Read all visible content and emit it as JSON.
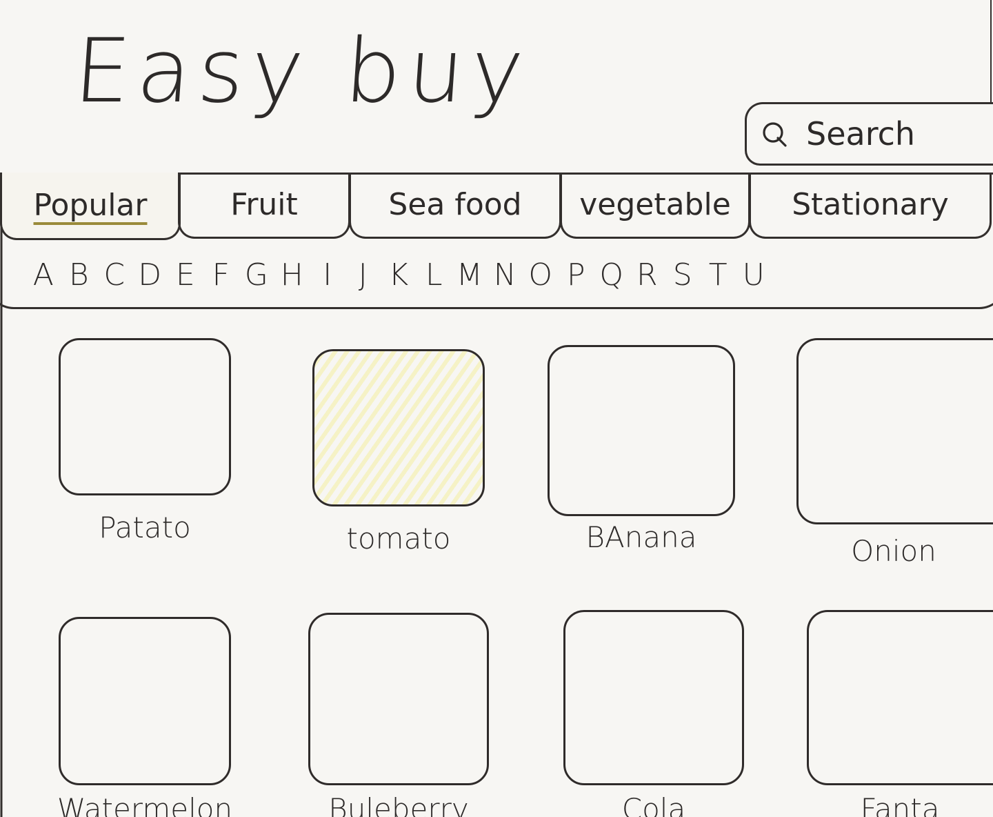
{
  "header": {
    "title": "Easy buy"
  },
  "search": {
    "placeholder": "Search",
    "icon": "search-icon"
  },
  "tabs": [
    {
      "label": "Popular",
      "active": true
    },
    {
      "label": "Fruit",
      "active": false
    },
    {
      "label": "Sea food",
      "active": false
    },
    {
      "label": "vegetable",
      "active": false
    },
    {
      "label": "Stationary",
      "active": false
    }
  ],
  "alphabet": [
    "A",
    "B",
    "C",
    "D",
    "E",
    "F",
    "G",
    "H",
    "I",
    "J",
    "K",
    "L",
    "M",
    "N",
    "O",
    "P",
    "Q",
    "R",
    "S",
    "T",
    "U"
  ],
  "products": [
    {
      "label": "Patato",
      "highlight": false
    },
    {
      "label": "tomato",
      "highlight": true
    },
    {
      "label": "BAnana",
      "highlight": false
    },
    {
      "label": "Onion",
      "highlight": false
    },
    {
      "label": "Watermelon",
      "highlight": false
    },
    {
      "label": "Buleberry",
      "highlight": false
    },
    {
      "label": "Cola",
      "highlight": false
    },
    {
      "label": "Fanta",
      "highlight": false
    }
  ]
}
